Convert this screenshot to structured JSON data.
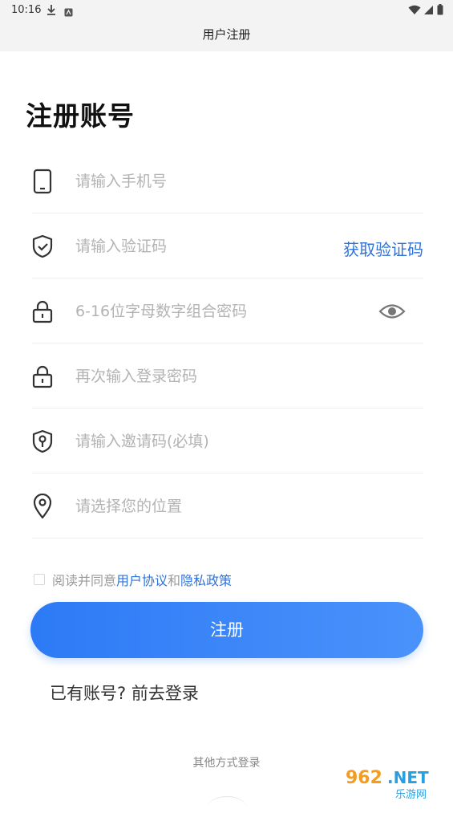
{
  "status": {
    "time": "10:16"
  },
  "header": {
    "title": "用户注册"
  },
  "page": {
    "heading": "注册账号"
  },
  "fields": {
    "phone": {
      "placeholder": "请输入手机号"
    },
    "code": {
      "placeholder": "请输入验证码",
      "action": "获取验证码"
    },
    "password": {
      "placeholder": "6-16位字母数字组合密码"
    },
    "confirm": {
      "placeholder": "再次输入登录密码"
    },
    "invite": {
      "placeholder": "请输入邀请码(必填)"
    },
    "location": {
      "placeholder": "请选择您的位置"
    }
  },
  "agreement": {
    "prefix": "阅读并同意",
    "terms": "用户协议",
    "and": "和",
    "privacy": "隐私政策"
  },
  "register_button": "注册",
  "login_link": "已有账号? 前去登录",
  "other_login": "其他方式登录",
  "watermark": "962.NET 乐游网",
  "colors": {
    "accent": "#2f73d9",
    "button_start": "#2d7af6",
    "button_end": "#4a92fb"
  }
}
